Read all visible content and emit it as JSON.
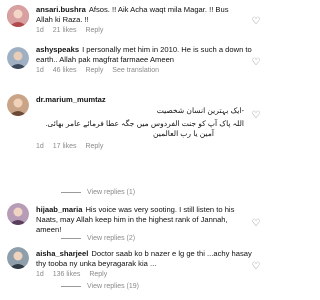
{
  "comments": [
    {
      "username": "ansari.bushra",
      "lines": [
        "Afsos. !! Aik Acha waqt mila Magar. !! Bus",
        "Allah ki Raza. !!"
      ],
      "time": "1d",
      "likes": "21 likes",
      "reply": "Reply",
      "translation": "",
      "avatar_color": "#c96b6b"
    },
    {
      "username": "ashyspeaks",
      "lines": [
        "I personally met him in 2010. He is such a down to",
        "earth.. Allah pak magfrat farmaee Ameen"
      ],
      "time": "1d",
      "likes": "46 likes",
      "reply": "Reply",
      "translation": "See translation",
      "avatar_color": "#7d8fa6"
    },
    {
      "username": "dr.marium_mumtaz",
      "lines": [
        "-ایک بہترین انسان شخصیت",
        "اللہ پاک آپ کو جنت الفردوس میں جگہ عطا فرمائے عامر بھائی.",
        "آمین یا رب العالمین"
      ],
      "time": "1d",
      "likes": "17 likes",
      "reply": "Reply",
      "translation": "",
      "avatar_color": "#b07a54",
      "view_replies": "View replies (1)"
    },
    {
      "username": "hijaab_maria",
      "lines": [
        "His voice was very sooting. I still listen to his",
        "Naats, may Allah keep him in the highest rank of Jannah,",
        "ameen!"
      ],
      "time": "1d",
      "likes": "15 likes",
      "reply": "Reply",
      "translation": "",
      "avatar_color": "#8a6e8e",
      "view_replies": "View replies (2)"
    },
    {
      "username": "aisha_sharjeel",
      "lines": [
        "Doctor saab ko b nazer e lg ge thi ...achy hasay",
        "thy tooba ny unka beyragarak kia ..."
      ],
      "time": "1d",
      "likes": "136 likes",
      "reply": "Reply",
      "translation": "",
      "avatar_color": "#5e6d7a",
      "view_replies": "View replies (19)"
    }
  ],
  "icons": {
    "like": "heart-outline-icon"
  }
}
